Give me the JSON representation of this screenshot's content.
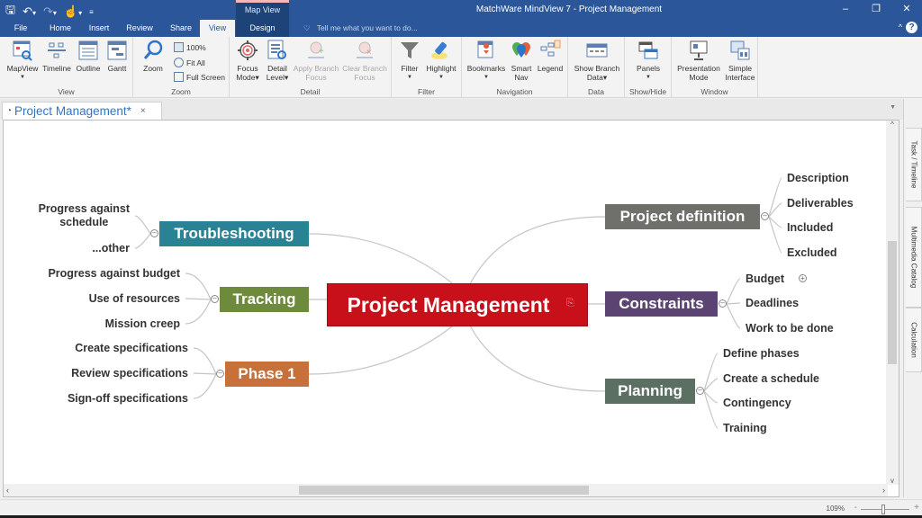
{
  "titlebar": {
    "app_title": "MatchWare MindView 7 - Project Management",
    "context_tab_header": "Map View",
    "qat": {
      "save_icon": "save-icon",
      "undo_icon": "undo-icon",
      "redo_icon": "redo-icon",
      "touch_icon": "touch-mode-icon",
      "customize_icon": "customize-qat-icon"
    },
    "window_controls": {
      "minimize": "–",
      "restore": "🗗",
      "close": "✕"
    }
  },
  "tabs": [
    {
      "label": "File",
      "active": false
    },
    {
      "label": "Home",
      "active": false
    },
    {
      "label": "Insert",
      "active": false
    },
    {
      "label": "Review",
      "active": false
    },
    {
      "label": "Share",
      "active": false
    },
    {
      "label": "View",
      "active": true
    },
    {
      "label": "Design",
      "active": false
    }
  ],
  "tell_me": "Tell me what you want to do...",
  "help_label": "?",
  "ribbon": {
    "groups": [
      {
        "name": "View",
        "buttons": [
          "MapView",
          "Timeline",
          "Outline",
          "Gantt"
        ]
      },
      {
        "name": "Zoom",
        "buttons": [
          "Zoom",
          "100%",
          "Fit All",
          "Full Screen"
        ]
      },
      {
        "name": "Detail",
        "buttons": [
          "Focus Mode",
          "Detail Level",
          "Apply Branch Focus",
          "Clear Branch Focus"
        ]
      },
      {
        "name": "Filter",
        "buttons": [
          "Filter",
          "Highlight"
        ]
      },
      {
        "name": "Navigation",
        "buttons": [
          "Bookmarks",
          "Smart Nav",
          "Legend"
        ]
      },
      {
        "name": "Data",
        "buttons": [
          "Show Branch Data"
        ]
      },
      {
        "name": "Show/Hide",
        "buttons": [
          "Panels"
        ]
      },
      {
        "name": "Window",
        "buttons": [
          "Presentation Mode",
          "Simple Interface"
        ]
      }
    ],
    "labels": {
      "mapview": "MapView",
      "timeline": "Timeline",
      "outline": "Outline",
      "gantt": "Gantt",
      "zoom": "Zoom",
      "zoom100": "100%",
      "fit_all": "Fit All",
      "full_screen": "Full Screen",
      "focus_mode_1": "Focus",
      "focus_mode_2": "Mode▾",
      "detail_level_1": "Detail",
      "detail_level_2": "Level▾",
      "apply_branch_1": "Apply Branch",
      "apply_branch_2": "Focus",
      "clear_branch_1": "Clear Branch",
      "clear_branch_2": "Focus",
      "filter": "Filter",
      "highlight": "Highlight",
      "bookmarks": "Bookmarks",
      "smart_nav_1": "Smart",
      "smart_nav_2": "Nav",
      "legend": "Legend",
      "show_branch_1": "Show Branch",
      "show_branch_2": "Data▾",
      "panels": "Panels",
      "presentation_1": "Presentation",
      "presentation_2": "Mode",
      "simple_1": "Simple",
      "simple_2": "Interface",
      "group_view": "View",
      "group_zoom": "Zoom",
      "group_detail": "Detail",
      "group_filter": "Filter",
      "group_navigation": "Navigation",
      "group_data": "Data",
      "group_showhide": "Show/Hide",
      "group_window": "Window"
    }
  },
  "document": {
    "tab_title": "Project Management*",
    "close_label": "×"
  },
  "side_panels": [
    "Task / Timeline",
    "Multimedia Catalog",
    "Calculation"
  ],
  "status": {
    "zoom_level": "109%",
    "zoom_fraction": 0.45
  },
  "mindmap": {
    "central": {
      "label": "Project Management",
      "color": "#c8101a"
    },
    "branches": [
      {
        "label": "Troubleshooting",
        "color": "#2a8395",
        "side": "left",
        "children": [
          "Progress against schedule",
          "...other"
        ]
      },
      {
        "label": "Tracking",
        "color": "#6e8a3d",
        "side": "left",
        "children": [
          "Progress against budget",
          "Use of resources",
          "Mission creep"
        ]
      },
      {
        "label": "Phase 1",
        "color": "#c7703a",
        "side": "left",
        "children": [
          "Create specifications",
          "Review specifications",
          "Sign-off specifications"
        ]
      },
      {
        "label": "Project definition",
        "color": "#6f6f6c",
        "side": "right",
        "children": [
          "Description",
          "Deliverables",
          "Included",
          "Excluded"
        ]
      },
      {
        "label": "Constraints",
        "color": "#5c4472",
        "side": "right",
        "children": [
          "Budget",
          "Deadlines",
          "Work to be done"
        ]
      },
      {
        "label": "Planning",
        "color": "#5b6f62",
        "side": "right",
        "children": [
          "Define phases",
          "Create a schedule",
          "Contingency",
          "Training"
        ]
      }
    ]
  }
}
